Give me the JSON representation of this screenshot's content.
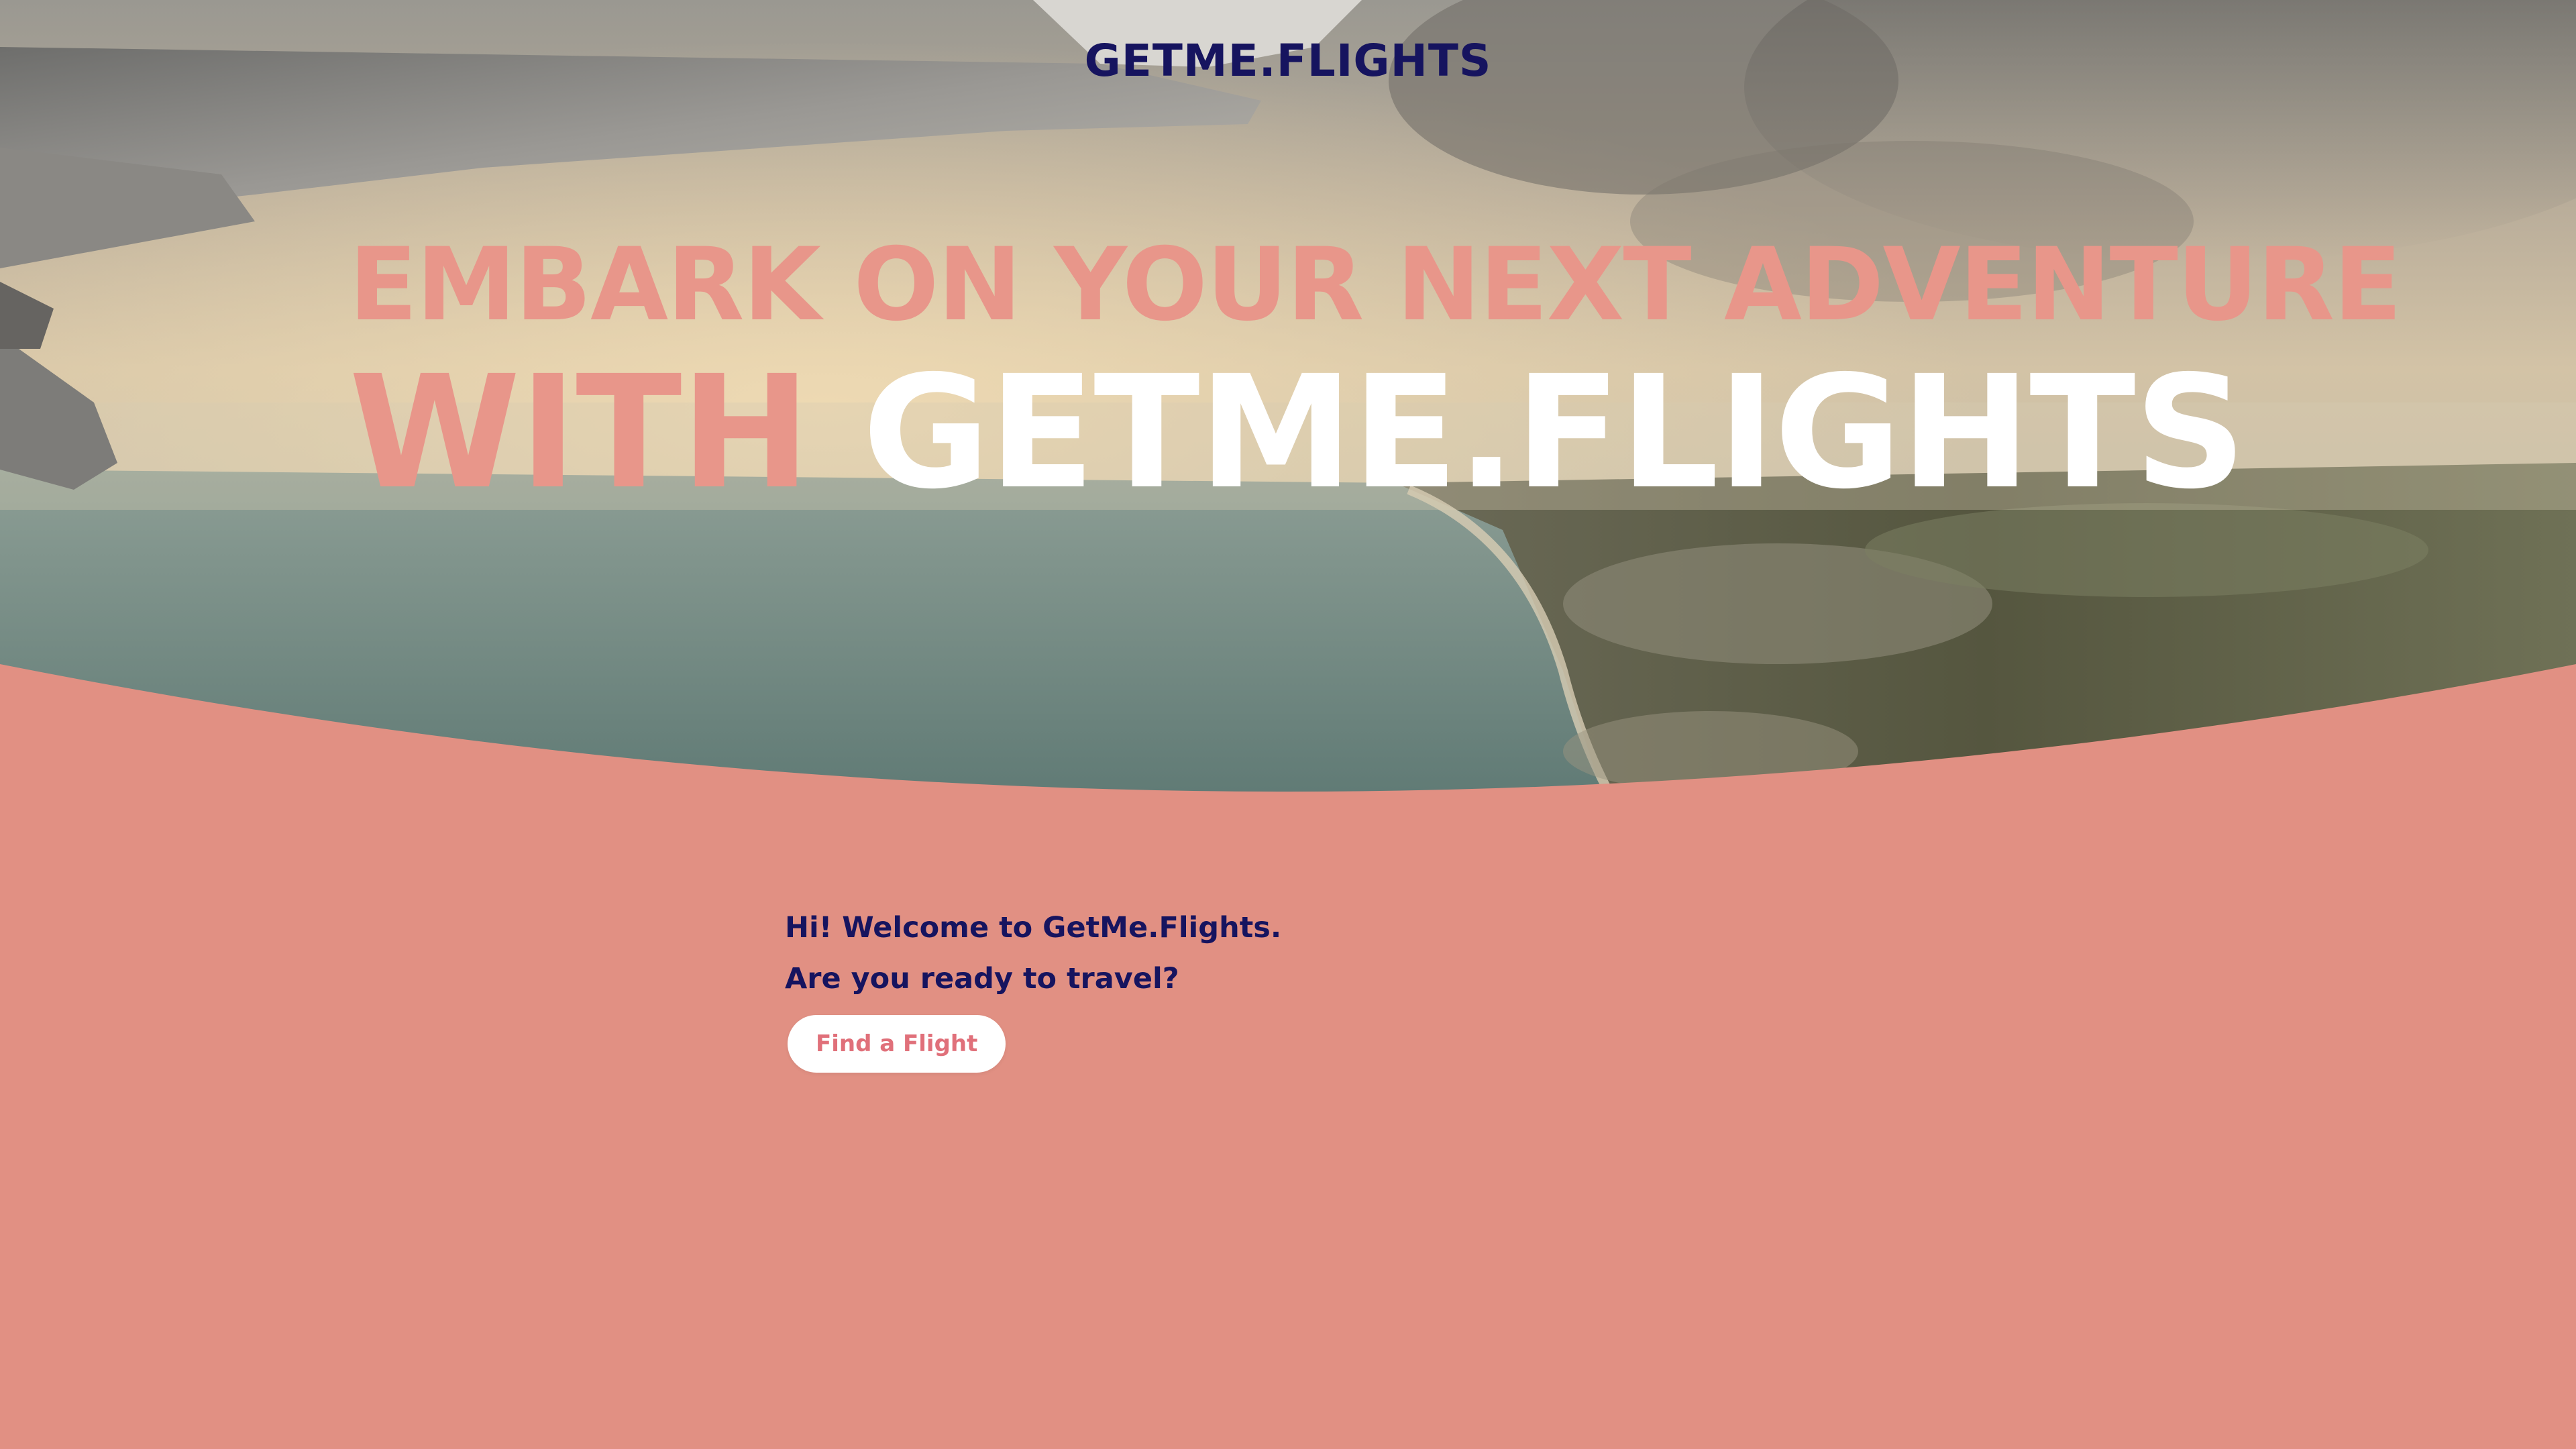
{
  "header": {
    "logo_text": "GETME.FLIGHTS"
  },
  "hero": {
    "headline_line1": "EMBARK ON YOUR NEXT ADVENTURE",
    "headline_with": "WITH",
    "headline_brand": "GETME.FLIGHTS",
    "image_description_icon": "airplane-wing-over-coast-photo"
  },
  "welcome": {
    "line1": "Hi! Welcome to GetMe.Flights.",
    "line2": "Are you ready to travel?",
    "button_label": "Find a Flight"
  },
  "colors": {
    "background": "#e19083",
    "logo": "#16145f",
    "headline_accent": "#e8968a",
    "headline_brand": "#ffffff",
    "welcome_text": "#16145f",
    "button_bg": "#ffffff",
    "button_text": "#e0707a"
  }
}
